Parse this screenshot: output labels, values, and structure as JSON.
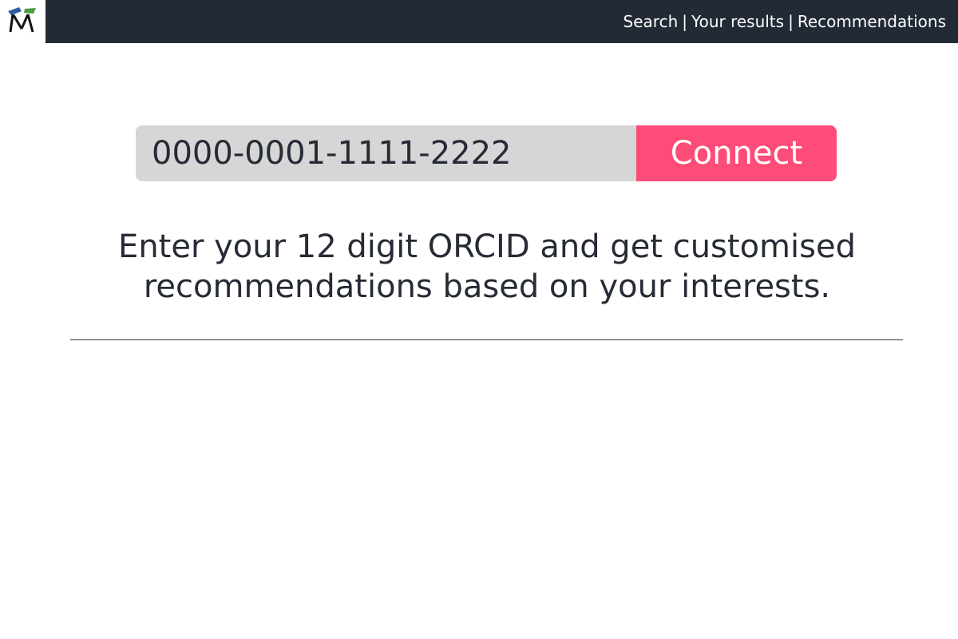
{
  "header": {
    "logo_icon": "mortarboard-m-logo-icon",
    "nav": {
      "search": "Search",
      "your_results": "Your results",
      "recommendations": "Recommendations",
      "separator": "|"
    },
    "colors": {
      "bar": "#222a35",
      "text": "#ffffff"
    }
  },
  "main": {
    "orcid_input": {
      "value": "0000-0001-1111-2222"
    },
    "connect_button": {
      "label": "Connect",
      "color": "#fd4c77"
    },
    "helper_line1": "Enter your 12 digit ORCID and get customised",
    "helper_line2": "recommendations based on your interests."
  }
}
